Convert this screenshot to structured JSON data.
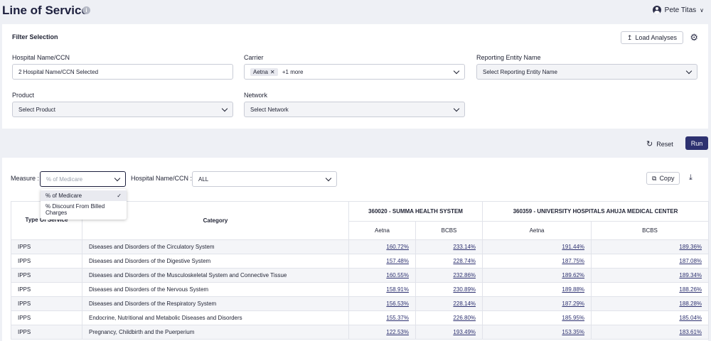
{
  "header": {
    "title": "Line of Service",
    "user_name": "Pete Titas"
  },
  "filter": {
    "title": "Filter Selection",
    "load_label": "Load Analyses",
    "hospital": {
      "label": "Hospital Name/CCN",
      "value": "2 Hospital Name/CCN Selected"
    },
    "carrier": {
      "label": "Carrier",
      "chip": "Aetna",
      "more": "+1 more"
    },
    "reporting": {
      "label": "Reporting Entity Name",
      "placeholder": "Select Reporting Entity Name"
    },
    "product": {
      "label": "Product",
      "placeholder": "Select Product"
    },
    "network": {
      "label": "Network",
      "placeholder": "Select Network"
    }
  },
  "actions": {
    "reset_label": "Reset",
    "run_label": "Run"
  },
  "results": {
    "measure_label": "Measure :",
    "measure_placeholder": "% of Medicare",
    "hosp_label": "Hospital Name/CCN :",
    "hosp_value": "ALL",
    "copy_label": "Copy",
    "dropdown_options": [
      "% of Medicare",
      "% Discount From Billed Charges"
    ],
    "table": {
      "col_type": "Type Of Service",
      "col_category": "Category",
      "hospitals": [
        "360020 - SUMMA HEALTH SYSTEM",
        "360359 - UNIVERSITY HOSPITALS AHUJA MEDICAL CENTER"
      ],
      "carriers": [
        "Aetna",
        "BCBS",
        "Aetna",
        "BCBS"
      ],
      "rows": [
        {
          "type": "IPPS",
          "category": "Diseases and Disorders of the Circulatory System",
          "v": [
            "160.72%",
            "233.14%",
            "191.44%",
            "189.36%"
          ]
        },
        {
          "type": "IPPS",
          "category": "Diseases and Disorders of the Digestive System",
          "v": [
            "157.48%",
            "228.74%",
            "187.75%",
            "187.08%"
          ]
        },
        {
          "type": "IPPS",
          "category": "Diseases and Disorders of the Musculoskeletal System and Connective Tissue",
          "v": [
            "160.55%",
            "232.86%",
            "189.62%",
            "189.34%"
          ]
        },
        {
          "type": "IPPS",
          "category": "Diseases and Disorders of the Nervous System",
          "v": [
            "158.91%",
            "230.89%",
            "189.88%",
            "188.26%"
          ]
        },
        {
          "type": "IPPS",
          "category": "Diseases and Disorders of the Respiratory System",
          "v": [
            "156.53%",
            "228.14%",
            "187.29%",
            "188.28%"
          ]
        },
        {
          "type": "IPPS",
          "category": "Endocrine, Nutritional and Metabolic Diseases and Disorders",
          "v": [
            "155.37%",
            "226.80%",
            "185.95%",
            "185.04%"
          ]
        },
        {
          "type": "IPPS",
          "category": "Pregnancy, Childbirth and the Puerperium",
          "v": [
            "122.53%",
            "193.49%",
            "153.35%",
            "183.61%"
          ]
        }
      ]
    }
  }
}
